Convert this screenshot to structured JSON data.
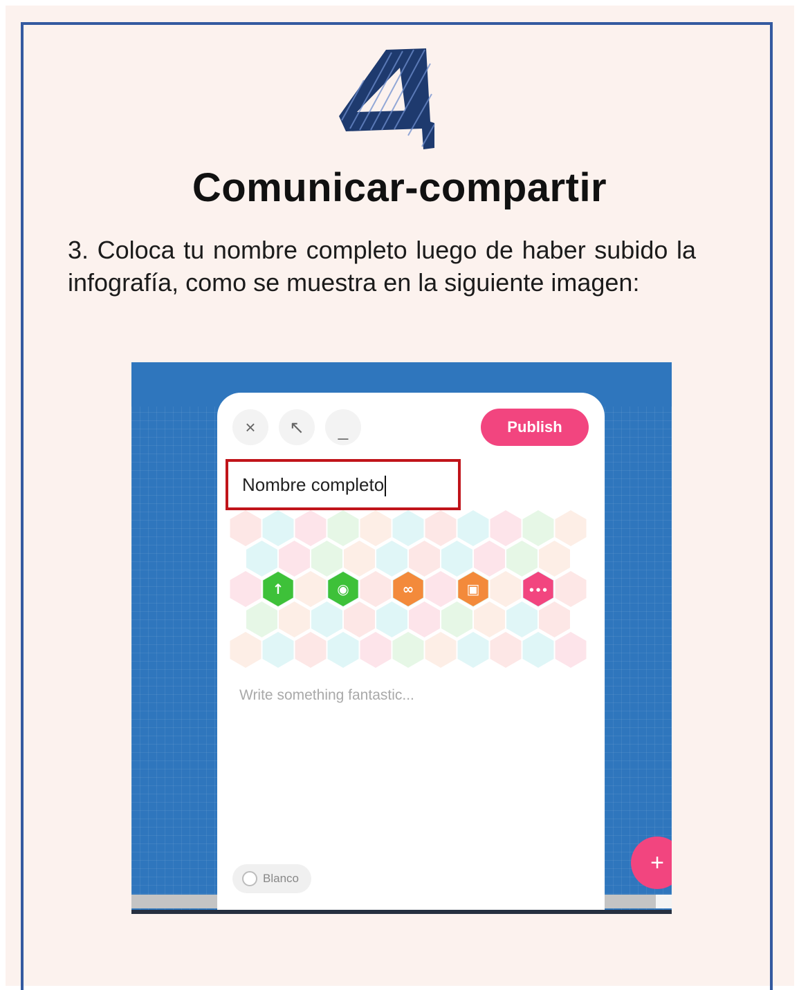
{
  "page": {
    "number": "4",
    "title": "Comunicar-compartir",
    "instruction": "3. Coloca tu nombre completo luego de haber subido la infografía, como se muestra en la siguiente imagen:"
  },
  "screenshot": {
    "toolbar": {
      "close_icon": "×",
      "expand_icon": "↖",
      "minimize_icon": "_",
      "publish_label": "Publish"
    },
    "title_field_value": "Nombre completo",
    "attachment_icons": [
      "upload-file-icon",
      "camera-icon",
      "link-icon",
      "image-search-icon",
      "more-icon"
    ],
    "attachment_colors": [
      "#3ec139",
      "#3ec139",
      "#f38a3b",
      "#f38a3b",
      "#f2457f"
    ],
    "body_placeholder": "Write something fantastic...",
    "color_option_label": "Blanco",
    "fab_label": "+"
  },
  "colors": {
    "frame": "#345aa0",
    "page_background": "#fcf2ee",
    "highlight": "#c0141a",
    "accent_pink": "#f2457f",
    "padlet_blue": "#2f76bd"
  }
}
